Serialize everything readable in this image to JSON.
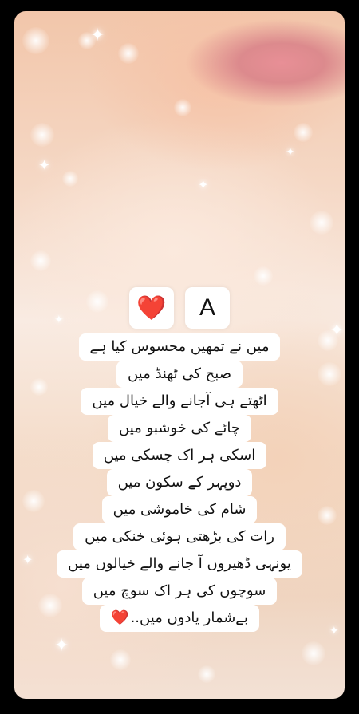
{
  "story": {
    "badges": {
      "heart_emoji": "❤️",
      "letter": "A"
    },
    "poem_lines": [
      "میں نے تمھیں محسوس کیا ہے",
      "صبح کی ٹھنڈ میں",
      "اٹھتے ہی آجانے والے خیال میں",
      "چائے کی خوشبو میں",
      "اسکی ہر اک چسکی میں",
      "دوپہر کے سکون میں",
      "شام کی خاموشی میں",
      "رات کی بڑھتی ہوئی خنکی میں",
      "یونہی ڈھیروں آ جانے والے خیالوں میں",
      "سوچوں کی ہر اک سوچ میں",
      "بےشمار یادوں میں.."
    ],
    "closing_emoji": "❤️",
    "colors": {
      "lips": "#e88f96",
      "skin": "#f5d8c5",
      "heart": "#d9222f"
    }
  }
}
